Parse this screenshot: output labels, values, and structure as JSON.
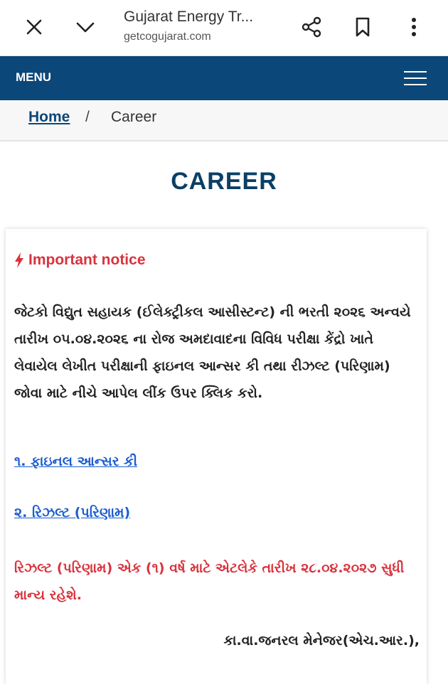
{
  "browser": {
    "title": "Gujarat Energy Tr...",
    "url": "getcogujarat.com",
    "icons": [
      "close-icon",
      "chevron-down-icon",
      "share-icon",
      "bookmark-icon",
      "more-vert-icon"
    ]
  },
  "nav": {
    "menu_label": "MENU"
  },
  "breadcrumb": {
    "home": "Home",
    "separator": "/",
    "current": "Career"
  },
  "page": {
    "title": "CAREER"
  },
  "notice": {
    "heading": "Important notice",
    "body": "જેટકો વિદ્યુત સહાયક (ઈલેક્ટ્રીકલ આસીસ્ટન્ટ) ની ભરતી ૨૦૨૬ અન્વયે તારીખ ૦૫.૦૪.૨૦૨૬ ના રોજ અમદાવાદના વિવિધ પરીક્ષા કેંદ્રો ખાતે લેવાયેલ લેખીત પરીક્ષાની ફાઇનલ આન્સર કી તથા રીઝલ્ટ (પરિણામ) જોવા માટે નીચે આપેલ લીંક ઉપર ક્લિક કરો.",
    "links": [
      {
        "label": "૧. ફાઇનલ આન્સર કી"
      },
      {
        "label": "૨. રિઝલ્ટ (પરિણામ)"
      }
    ],
    "validity": "રિઝલ્ટ (પરિણામ) એક (૧) વર્ષ માટે એટલેકે તારીખ ૨૮.૦૪.૨૦૨૭ સુધી માન્ય રહેશે.",
    "signature": "કા.વા.જનરલ મેનેજર(એચ.આર.),"
  },
  "colors": {
    "nav_bg": "#0b4778",
    "title": "#0b3f66",
    "notice_red": "#d9333d",
    "link_blue": "#1a5dd0"
  }
}
